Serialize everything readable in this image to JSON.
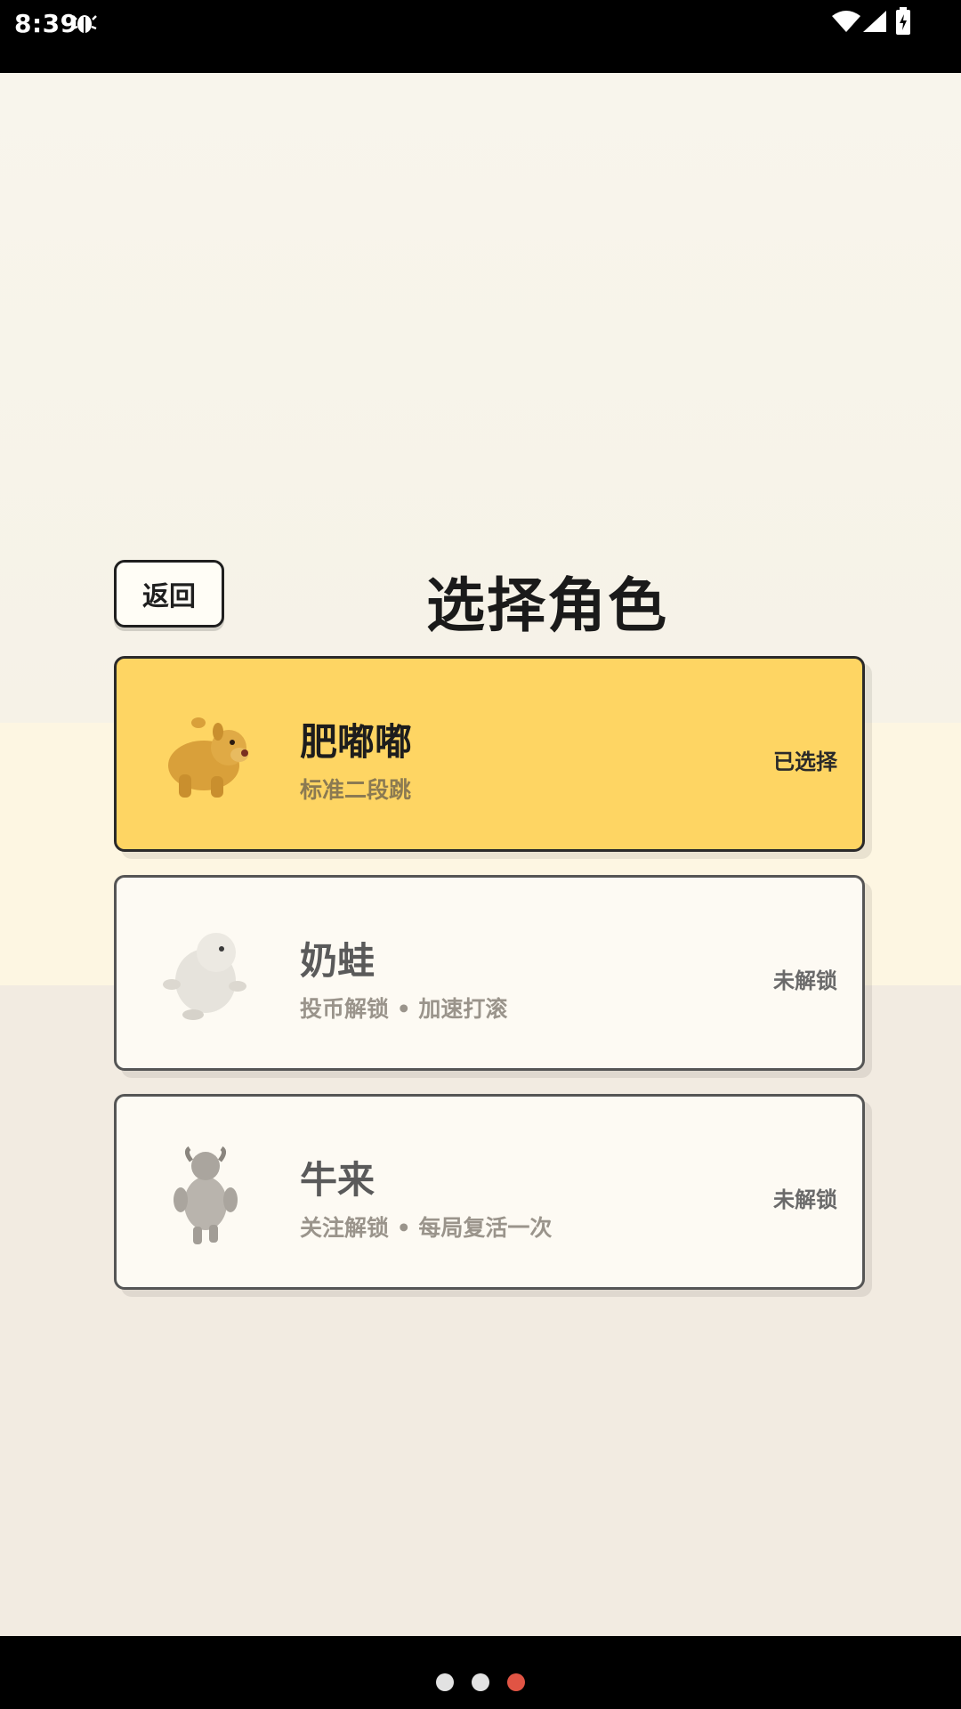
{
  "status_bar": {
    "time": "8:39",
    "icons": [
      "bug-icon",
      "wifi-icon",
      "signal-icon",
      "battery-icon"
    ]
  },
  "header": {
    "back_label": "返回",
    "title": "选择角色"
  },
  "characters": [
    {
      "name": "肥嘟嘟",
      "desc": "标准二段跳",
      "status": "已选择",
      "selected": true,
      "icon": "dog-icon"
    },
    {
      "name": "奶蛙",
      "desc": "投币解锁 • 加速打滚",
      "status": "未解锁",
      "selected": false,
      "icon": "white-frog-icon"
    },
    {
      "name": "牛来",
      "desc": "关注解锁 • 每局复活一次",
      "status": "未解锁",
      "selected": false,
      "icon": "bull-icon"
    }
  ],
  "page_indicator": {
    "count": 3,
    "active": 3
  },
  "colors": {
    "selected_card": "#fed563",
    "card": "#fdfaf3",
    "active_dot": "#e05444",
    "inactive_dot": "#e2e2e2"
  }
}
